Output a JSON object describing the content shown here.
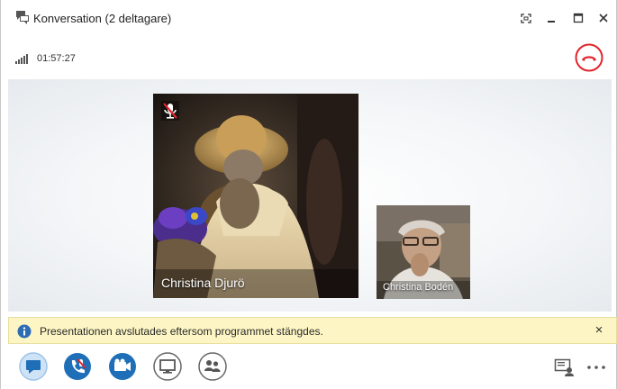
{
  "window": {
    "title": "Konversation (2 deltagare)",
    "app_icon": "conversation-icon",
    "controls": [
      "fullscreen-icon",
      "minimize-icon",
      "maximize-icon",
      "close-icon"
    ]
  },
  "call": {
    "duration": "01:57:27",
    "signal_icon": "signal-strength-icon",
    "hangup_icon": "hangup-icon",
    "hangup_color": "#e0242b"
  },
  "participants": [
    {
      "name": "Christina Djurö",
      "muted": true
    },
    {
      "name": "Christina Bodén",
      "muted": false
    }
  ],
  "notification": {
    "text": "Presentationen avslutades eftersom programmet stängdes.",
    "icon": "info-icon",
    "close_label": "×",
    "background": "#fdf6c4"
  },
  "toolbar": {
    "accent": "#1e6fb8",
    "buttons": [
      "im-icon",
      "call-controls-icon",
      "video-icon",
      "present-icon",
      "participants-icon"
    ],
    "right": [
      "room-view-icon",
      "more-options-icon"
    ]
  }
}
